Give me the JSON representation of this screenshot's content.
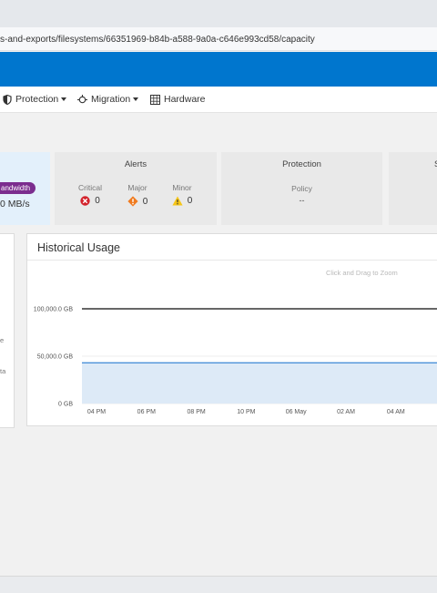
{
  "browser": {
    "url_fragment": "s-and-exports/filesystems/66351969-b84b-a588-9a0a-c646e993cd58/capacity"
  },
  "menu": {
    "protection": {
      "label": "Protection",
      "icon": "shield-icon"
    },
    "migration": {
      "label": "Migration",
      "icon": "migration-icon"
    },
    "hardware": {
      "label": "Hardware",
      "icon": "hardware-grid-icon"
    }
  },
  "summary": {
    "bandwidth": {
      "label_fragment": "andwidth",
      "value_fragment": "0 MB/s"
    },
    "alerts": {
      "title": "Alerts",
      "critical": {
        "label": "Critical",
        "value": "0",
        "color": "#d3232c"
      },
      "major": {
        "label": "Major",
        "value": "0",
        "color": "#f07b1f"
      },
      "minor": {
        "label": "Minor",
        "value": "0",
        "color": "#f5c518"
      }
    },
    "protection": {
      "title": "Protection",
      "policy_label": "Policy",
      "policy_value": "--"
    },
    "next_card_title_fragment": "S"
  },
  "left_panel": {
    "fragment_1": "e",
    "fragment_2": "ta"
  },
  "historical_usage": {
    "title": "Historical Usage",
    "zoom_hint": "Click and Drag to Zoom"
  },
  "chart_data": {
    "type": "area",
    "title": "Historical Usage",
    "x_tick_labels": [
      "04 PM",
      "06 PM",
      "08 PM",
      "10 PM",
      "06 May",
      "02 AM",
      "04 AM"
    ],
    "y_tick_labels": [
      "0 GB",
      "50,000.0 GB",
      "100,000.0 GB"
    ],
    "ylim": [
      0,
      100000
    ],
    "grid": "horizontal",
    "series": [
      {
        "role": "total",
        "color": "#333333",
        "values": [
          100000,
          100000,
          100000,
          100000,
          100000,
          100000,
          100000
        ]
      },
      {
        "role": "used",
        "color": "#4a90d9",
        "fill": "#ddeaf7",
        "values": [
          43000,
          43000,
          43000,
          43000,
          43000,
          43000,
          43000
        ]
      }
    ]
  }
}
